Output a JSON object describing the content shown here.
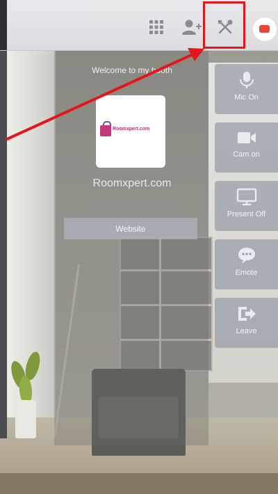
{
  "topbar": {
    "icons": [
      "grid-icon",
      "add-user-icon",
      "tools-icon",
      "avatar"
    ]
  },
  "booth": {
    "welcome_text": "Welcome to my booth",
    "logo_text": "Roomxpert.com",
    "site_name": "Roomxpert.com",
    "website_button": "Website"
  },
  "controls": [
    {
      "label": "Mic On",
      "icon": "microphone-icon"
    },
    {
      "label": "Cam on",
      "icon": "camera-icon"
    },
    {
      "label": "Present Off",
      "icon": "monitor-icon"
    },
    {
      "label": "Emote",
      "icon": "chat-bubble-icon"
    },
    {
      "label": "Leave",
      "icon": "exit-icon"
    }
  ],
  "colors": {
    "highlight": "#e4161b",
    "arrow": "#e4161b",
    "rail_button": "#969ca8"
  }
}
